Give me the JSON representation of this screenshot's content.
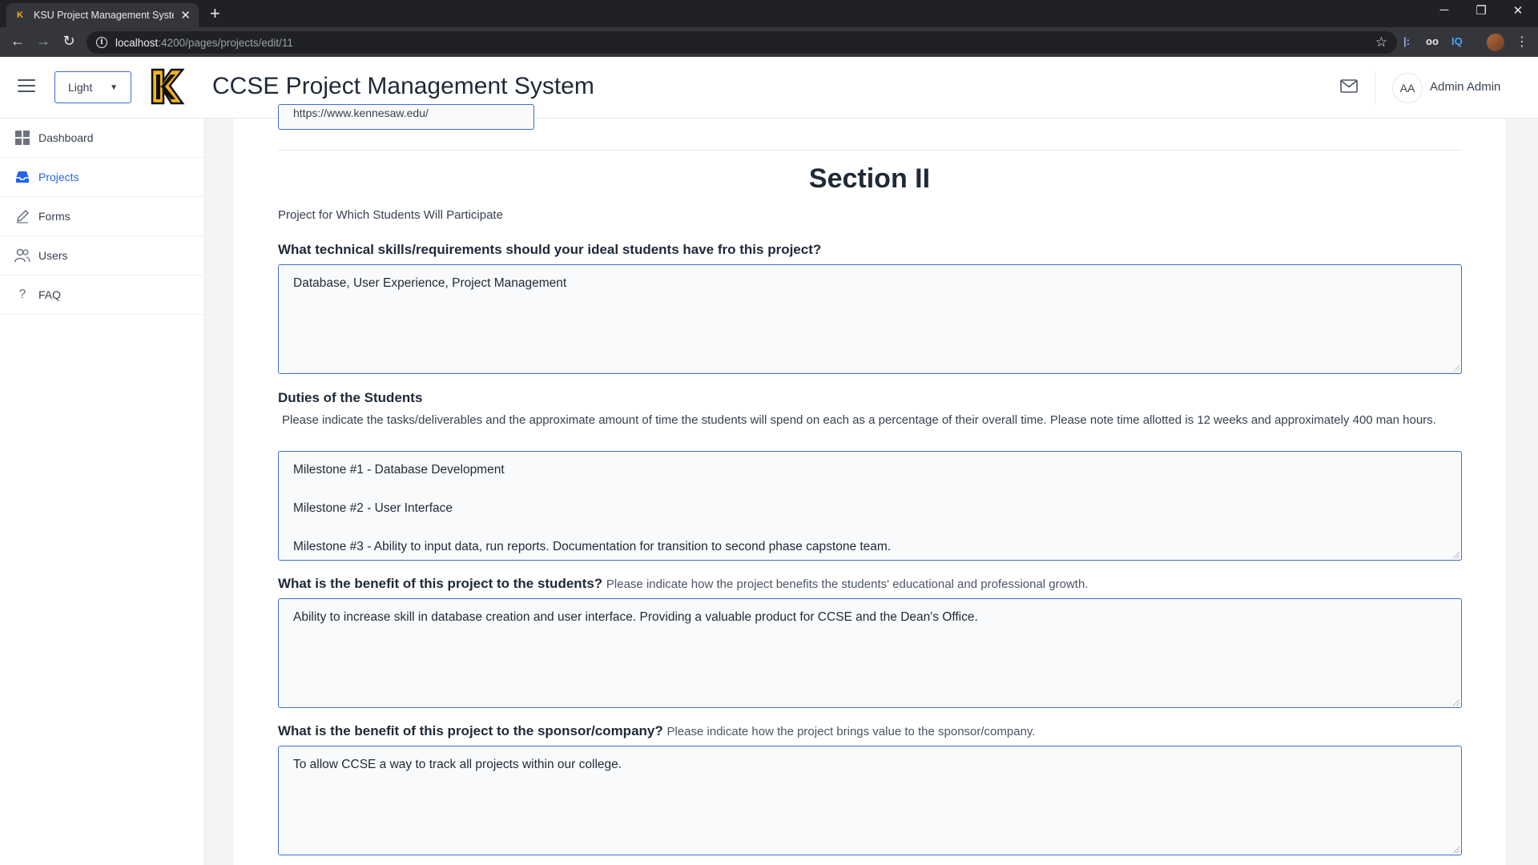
{
  "browser": {
    "tab_title": "KSU Project Management System",
    "new_tab_label": "+",
    "url_host": "localhost",
    "url_path": ":4200/pages/projects/edit/11",
    "extensions": [
      "|:",
      "oo",
      "IQ"
    ]
  },
  "header": {
    "theme_value": "Light",
    "app_title": "CCSE Project Management System",
    "avatar_initials": "AA",
    "user_name": "Admin Admin"
  },
  "sidebar": {
    "items": [
      {
        "label": "Dashboard",
        "icon": "grid-icon"
      },
      {
        "label": "Projects",
        "icon": "inbox-icon",
        "active": true
      },
      {
        "label": "Forms",
        "icon": "pencil-icon"
      },
      {
        "label": "Users",
        "icon": "users-icon"
      },
      {
        "label": "FAQ",
        "icon": "question-icon"
      }
    ]
  },
  "form": {
    "website_value": "https://www.kennesaw.edu/",
    "section_title": "Section II",
    "section_subtitle": "Project for Which Students Will Participate",
    "skills": {
      "label": "What technical skills/requirements should your ideal students have fro this project?",
      "value": "Database, User Experience, Project Management"
    },
    "duties": {
      "label": "Duties of the Students",
      "hint": "Please indicate the tasks/deliverables and the approximate amount of time the students will spend on each as a percentage of their overall time. Please note time allotted is 12 weeks and approximately 400 man hours.",
      "lines": [
        "Milestone #1 - Database Development",
        "",
        "Milestone #2 - User Interface",
        "",
        "Milestone #3 - Ability to input data, run reports. Documentation for transition to second phase capstone team."
      ]
    },
    "student_benefit": {
      "label": "What is the benefit of this project to the students?",
      "hint": "Please indicate how the project benefits the students' educational and professional growth.",
      "value": "Ability to increase skill in database creation and user interface.  Providing a valuable product for CCSE and the Dean's Office."
    },
    "sponsor_benefit": {
      "label": "What is the benefit of this project to the sponsor/company?",
      "hint": "Please indicate how the project brings value to the sponsor/company.",
      "value": "To allow CCSE a way to track all projects within our college."
    }
  }
}
